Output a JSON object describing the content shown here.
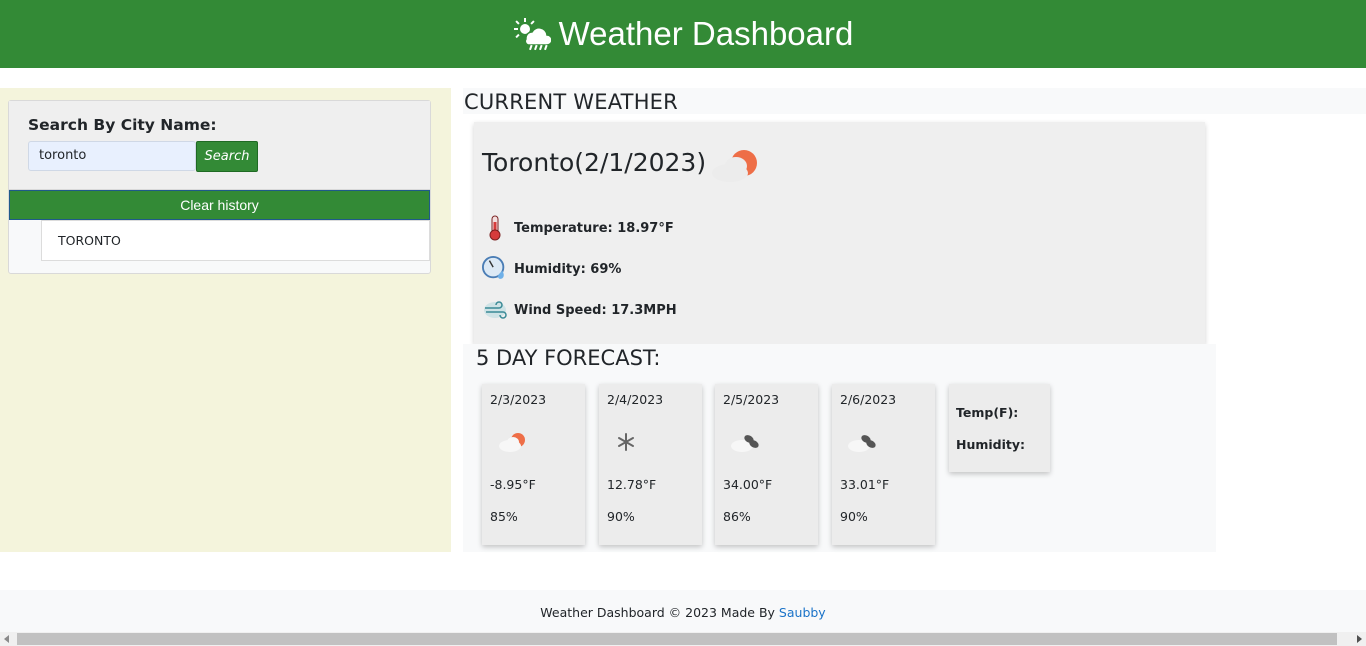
{
  "header": {
    "title": "Weather Dashboard",
    "icon": "sun-cloud-rain-icon"
  },
  "sidebar": {
    "search_label": "Search By City Name:",
    "search_value": "toronto",
    "search_button": "Search",
    "clear_button": "Clear history",
    "history": [
      "TORONTO"
    ]
  },
  "current": {
    "section_title": "CURRENT WEATHER",
    "city_date": "Toronto(2/1/2023)",
    "icon": "partly-cloudy-icon",
    "temperature": "Temperature: 18.97°F",
    "humidity": "Humidity: 69%",
    "wind": "Wind Speed: 17.3MPH"
  },
  "forecast": {
    "title": "5 DAY FORECAST:",
    "days": [
      {
        "date": "2/3/2023",
        "icon": "partly-cloudy-icon",
        "temp": "-8.95°F",
        "humidity": "85%"
      },
      {
        "date": "2/4/2023",
        "icon": "snow-icon",
        "temp": "12.78°F",
        "humidity": "90%"
      },
      {
        "date": "2/5/2023",
        "icon": "broken-clouds-icon",
        "temp": "34.00°F",
        "humidity": "86%"
      },
      {
        "date": "2/6/2023",
        "icon": "broken-clouds-icon",
        "temp": "33.01°F",
        "humidity": "90%"
      }
    ],
    "labels": {
      "temp": "Temp(F):",
      "humidity": "Humidity:"
    }
  },
  "footer": {
    "text": "Weather Dashboard © 2023 Made By ",
    "link": "Saubby",
    "link_color": "#1a73c8"
  },
  "colors": {
    "brand": "#338a36",
    "sidebar_bg": "#f4f4dc",
    "sun": "#ee6e47"
  }
}
